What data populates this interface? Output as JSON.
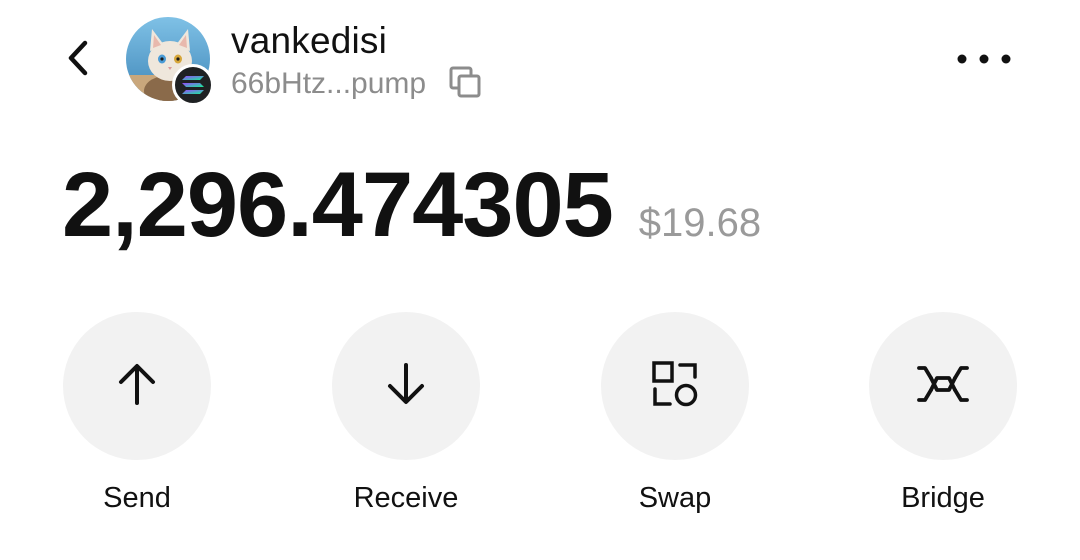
{
  "header": {
    "token_name": "vankedisi",
    "address": "66bHtz...pump",
    "back_icon": "chevron-left-icon",
    "copy_icon": "copy-icon",
    "more_icon": "more-horizontal-icon",
    "avatar_icon": "cat-avatar-icon",
    "chain_icon": "solana-icon"
  },
  "balance": {
    "amount": "2,296.474305",
    "usd_value": "$19.68"
  },
  "actions": [
    {
      "label": "Send",
      "icon": "arrow-up-icon"
    },
    {
      "label": "Receive",
      "icon": "arrow-down-icon"
    },
    {
      "label": "Swap",
      "icon": "swap-icon"
    },
    {
      "label": "Bridge",
      "icon": "bridge-icon"
    }
  ],
  "colors": {
    "text_primary": "#111111",
    "text_secondary": "#8c8c8c",
    "button_background": "#f2f2f2",
    "background": "#ffffff"
  }
}
